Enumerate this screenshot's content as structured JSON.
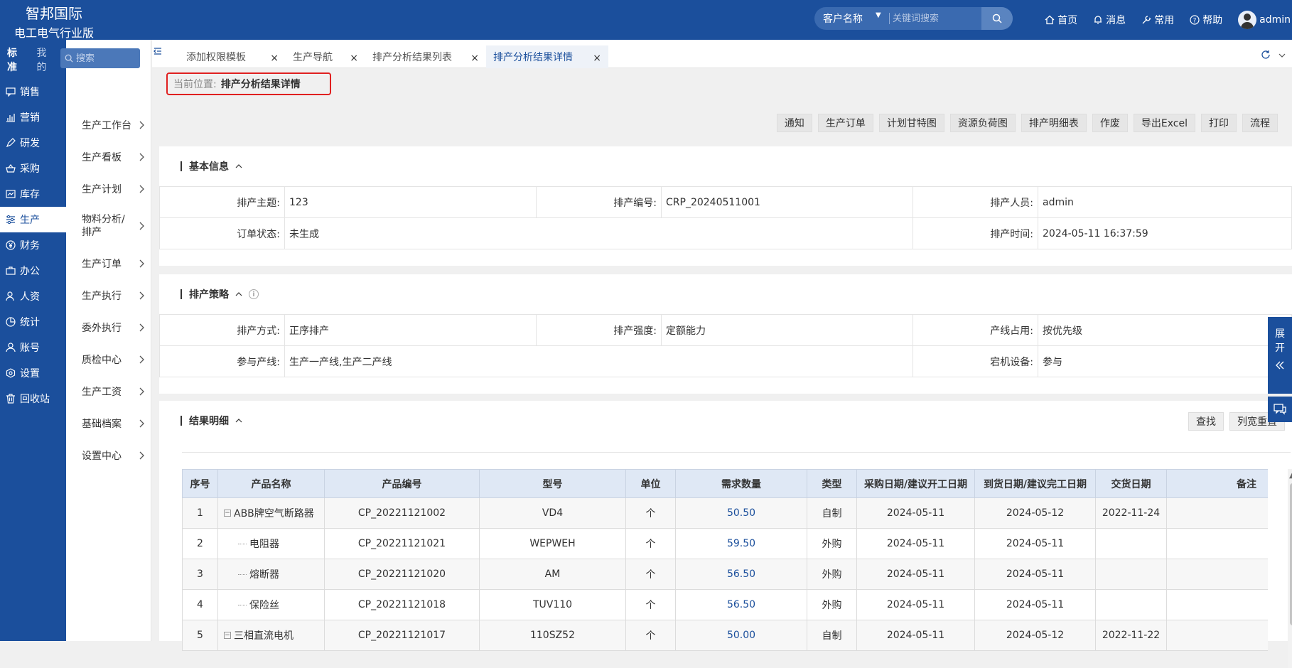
{
  "header": {
    "brand_line1": "智邦国际",
    "brand_line2": "电工电气行业版",
    "search_type": "客户名称",
    "search_placeholder": "关键词搜索",
    "nav": {
      "home": "首页",
      "messages": "消息",
      "common": "常用",
      "help": "帮助",
      "user": "admin"
    }
  },
  "leftnav": {
    "tab_standard": "标准",
    "tab_mine": "我的",
    "items": [
      "销售",
      "营销",
      "研发",
      "采购",
      "库存",
      "生产",
      "财务",
      "办公",
      "人资",
      "统计",
      "账号",
      "设置",
      "回收站"
    ]
  },
  "subnav": {
    "search_placeholder": "搜索",
    "items": [
      "生产工作台",
      "生产看板",
      "生产计划",
      "物料分析/排产",
      "生产订单",
      "生产执行",
      "委外执行",
      "质检中心",
      "生产工资",
      "基础档案",
      "设置中心"
    ]
  },
  "tabs": [
    "添加权限模板",
    "生产导航",
    "排产分析结果列表",
    "排产分析结果详情"
  ],
  "breadcrumb": {
    "label": "当前位置:",
    "value": "排产分析结果详情"
  },
  "toolbar": [
    "通知",
    "生产订单",
    "计划甘特图",
    "资源负荷图",
    "排产明细表",
    "作废",
    "导出Excel",
    "打印",
    "流程"
  ],
  "basic": {
    "title": "基本信息",
    "subject_k": "排产主题:",
    "subject_v": "123",
    "code_k": "排产编号:",
    "code_v": "CRP_20240511001",
    "person_k": "排产人员:",
    "person_v": "admin",
    "status_k": "订单状态:",
    "status_v": "未生成",
    "time_k": "排产时间:",
    "time_v": "2024-05-11 16:37:59"
  },
  "strategy": {
    "title": "排产策略",
    "method_k": "排产方式:",
    "method_v": "正序排产",
    "intensity_k": "排产强度:",
    "intensity_v": "定额能力",
    "line_k": "产线占用:",
    "line_v": "按优先级",
    "lines_k": "参与产线:",
    "lines_v": "生产一产线,生产二产线",
    "idle_k": "宕机设备:",
    "idle_v": "参与"
  },
  "results": {
    "title": "结果明细",
    "find": "查找",
    "reset": "列宽重置",
    "headers": [
      "序号",
      "产品名称",
      "产品编号",
      "型号",
      "单位",
      "需求数量",
      "类型",
      "采购日期/建议开工日期",
      "到货日期/建议完工日期",
      "交货日期",
      "备注"
    ],
    "rows": [
      [
        "1",
        "ABB牌空气断路器",
        "CP_20221121002",
        "VD4",
        "个",
        "50.50",
        "自制",
        "2024-05-11",
        "2024-05-12",
        "2022-11-24",
        ""
      ],
      [
        "2",
        "电阻器",
        "CP_20221121021",
        "WEPWEH",
        "个",
        "59.50",
        "外购",
        "2024-05-11",
        "2024-05-11",
        "",
        ""
      ],
      [
        "3",
        "熔断器",
        "CP_20221121020",
        "AM",
        "个",
        "56.50",
        "外购",
        "2024-05-11",
        "2024-05-11",
        "",
        ""
      ],
      [
        "4",
        "保险丝",
        "CP_20221121018",
        "TUV110",
        "个",
        "56.50",
        "外购",
        "2024-05-11",
        "2024-05-11",
        "",
        ""
      ],
      [
        "5",
        "三相直流电机",
        "CP_20221121017",
        "110SZ52",
        "个",
        "50.00",
        "自制",
        "2024-05-11",
        "2024-05-12",
        "2022-11-22",
        ""
      ]
    ]
  },
  "side": {
    "expand": "展开"
  }
}
